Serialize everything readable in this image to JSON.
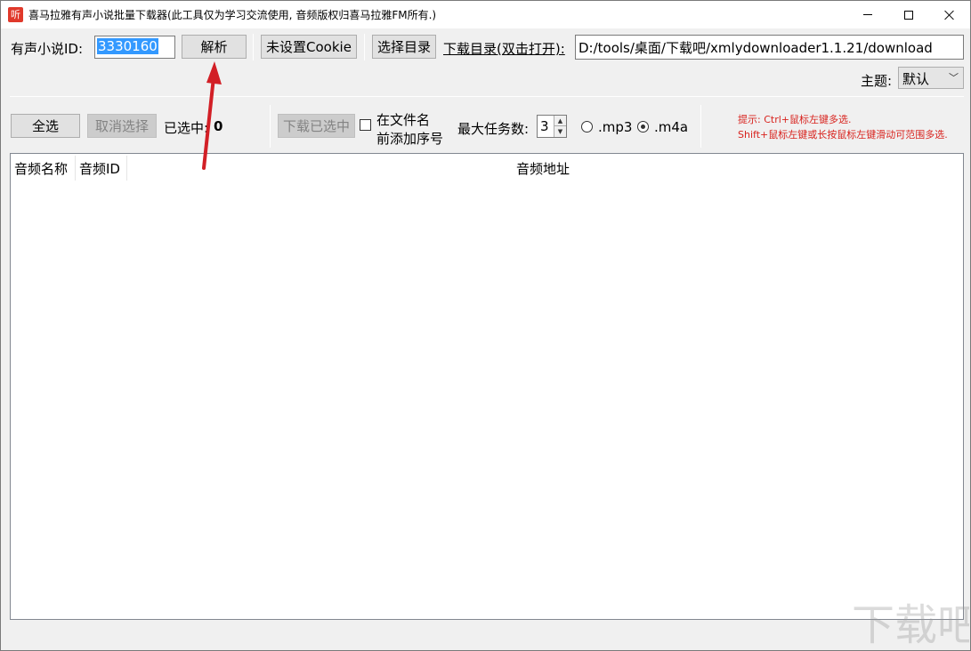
{
  "window": {
    "title": "喜马拉雅有声小说批量下载器(此工具仅为学习交流使用, 音频版权归喜马拉雅FM所有.)",
    "app_icon_text": "听"
  },
  "toolbar": {
    "album_id_label": "有声小说ID:",
    "album_id_value": "3330160",
    "parse_button": "解析",
    "cookie_button": "未设置Cookie",
    "choose_dir_button": "选择目录",
    "download_dir_label": "下载目录(双击打开):",
    "download_dir_value": "D:/tools/桌面/下载吧/xmlydownloader1.1.21/download",
    "theme_label": "主题:",
    "theme_value": "默认"
  },
  "actions": {
    "select_all": "全选",
    "deselect": "取消选择",
    "selected_label": "已选中:",
    "selected_count": "0",
    "download_selected": "下载已选中",
    "prefix_checkbox_line1": "在文件名",
    "prefix_checkbox_line2": "前添加序号",
    "max_tasks_label": "最大任务数:",
    "max_tasks_value": "3",
    "format_mp3": ".mp3",
    "format_m4a": ".m4a",
    "selected_format": ".m4a"
  },
  "hints": {
    "line1": "提示: Ctrl+鼠标左键多选.",
    "line2": "Shift+鼠标左键或长按鼠标左键滑动可范围多选."
  },
  "table": {
    "columns": [
      "音频名称",
      "音频ID",
      "音频地址"
    ],
    "rows": []
  },
  "colors": {
    "hint_red": "#d8231e",
    "arrow_red": "#d21f26",
    "selection_blue": "#3399ff"
  },
  "watermark_text": "下载吧"
}
